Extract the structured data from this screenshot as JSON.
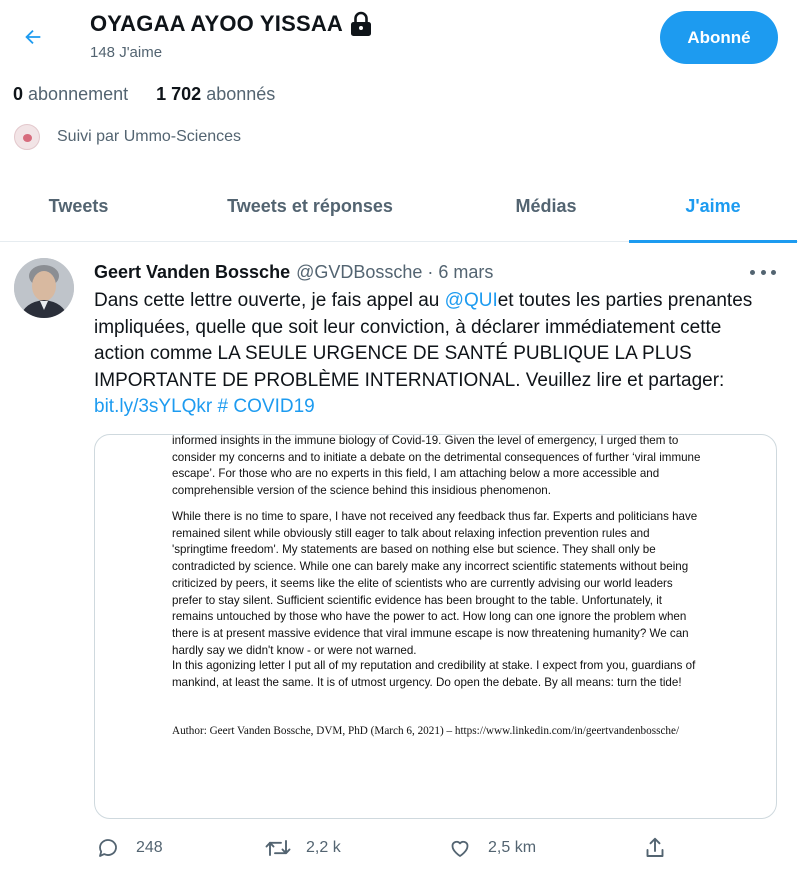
{
  "header": {
    "profile_name": "OYAGAA AYOO YISSAA",
    "likes_count": "148 J'aime",
    "follow_label": "Abonné"
  },
  "stats": {
    "following_value": "0",
    "following_label": "abonnement",
    "followers_value": "1 702",
    "followers_label": "abonnés"
  },
  "followed_by": "Suivi par Ummo-Sciences",
  "tabs": [
    {
      "label": "Tweets"
    },
    {
      "label": "Tweets et réponses"
    },
    {
      "label": "Médias"
    },
    {
      "label": "J'aime",
      "active": true
    }
  ],
  "tweet": {
    "author_name": "Geert Vanden Bossche",
    "author_handle": "@GVDBossche",
    "separator": "·",
    "date": "6 mars",
    "text_part1": "Dans cette lettre ouverte, je fais appel au ",
    "mention": "@QUI",
    "text_part2": "et toutes les parties prenantes impliquées, quelle que soit leur conviction, à déclarer immédiatement cette action comme LA SEULE URGENCE DE SANTÉ PUBLIQUE LA PLUS IMPORTANTE DE PROBLÈME INTERNATIONAL. Veuillez lire et partager:  ",
    "link": "bit.ly/3sYLQkr",
    "hashtag": "# COVID19",
    "document": {
      "para1": "informed insights in the immune biology of Covid-19. Given the level of emergency, I urged them to consider my concerns and to initiate a debate on the detrimental consequences of further ‘viral immune escape’. For those who are no experts in this field, I am attaching below a more accessible and comprehensible version of the science behind this insidious phenomenon.",
      "para2": "While there is no time to spare, I have not received any feedback thus far. Experts and politicians have remained silent while obviously still eager to talk about relaxing infection prevention rules and 'springtime freedom'. My statements are based on nothing else but science. They shall only be contradicted by science. While one can barely make any incorrect scientific statements without being criticized by peers, it seems like the elite of scientists who are currently advising our world leaders prefer to stay silent. Sufficient scientific evidence has been brought to the table. Unfortunately, it remains untouched by those who have the power to act. How long can one ignore the problem when there is at present massive evidence that viral immune escape is now threatening humanity? We can hardly say we didn't know - or were not warned.",
      "para3": "In this agonizing letter I put all of my reputation and credibility at stake. I expect from you, guardians of mankind, at least the same. It is of utmost urgency. Do open the debate. By all means: turn the tide!",
      "author_line": "Author: Geert Vanden Bossche, DVM, PhD (March 6, 2021) – https://www.linkedin.com/in/geertvandenbossche/"
    },
    "actions": {
      "reply_count": "248",
      "retweet_count": "2,2 k",
      "like_count": "2,5 km"
    }
  },
  "colors": {
    "accent": "#1d9bf0",
    "text_primary": "#0f1419",
    "text_secondary": "#536471",
    "border": "#cfd9de"
  },
  "icons": [
    "back-arrow-icon",
    "lock-icon",
    "more-icon",
    "reply-icon",
    "retweet-icon",
    "like-icon",
    "share-icon"
  ]
}
